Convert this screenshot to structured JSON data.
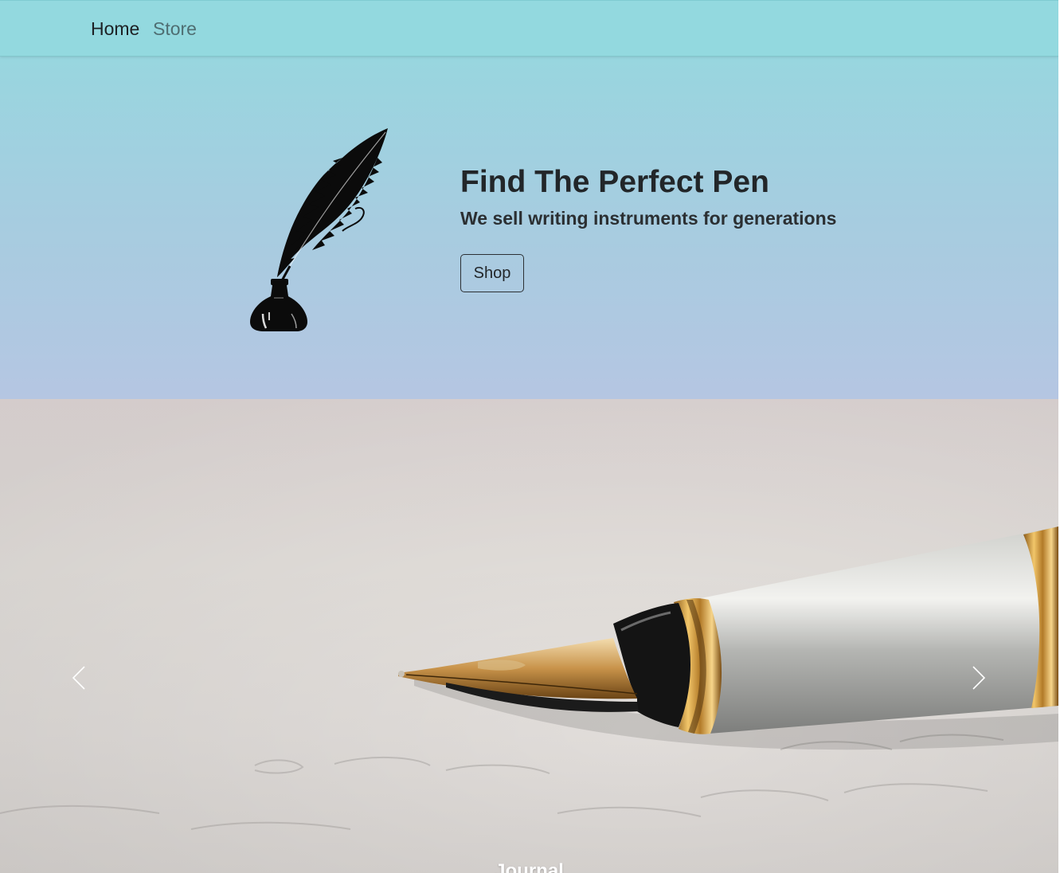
{
  "nav": {
    "items": [
      {
        "label": "Home"
      },
      {
        "label": "Store"
      }
    ]
  },
  "hero": {
    "logo_icon": "quill-inkwell-icon",
    "title": "Find The Perfect Pen",
    "subtitle": "We sell writing instruments for generations",
    "button_label": "Shop"
  },
  "carousel": {
    "slide_image": "fountain-pen-photo",
    "caption": "Journal",
    "prev_icon": "chevron-left-icon",
    "next_icon": "chevron-right-icon"
  },
  "colors": {
    "navbar": "#93d9df",
    "hero_top": "#98d6df",
    "hero_bottom": "#b5c6e2",
    "text_dark": "#222629",
    "nav_inactive": "#4f6e72"
  }
}
